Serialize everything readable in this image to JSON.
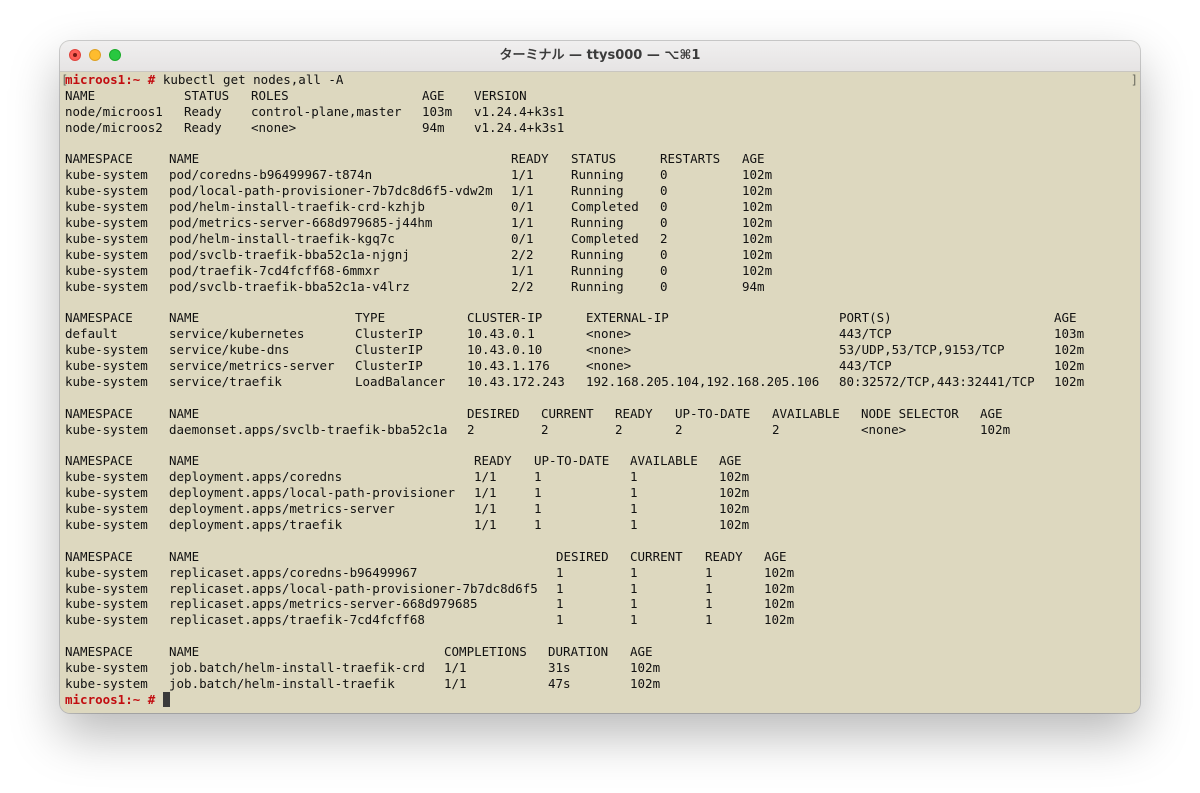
{
  "window": {
    "title": "ターミナル — ttys000 — ⌥⌘1",
    "icons": {
      "close": "close-icon",
      "minimize": "minimize-icon",
      "maximize": "zoom-icon"
    },
    "colors": {
      "background": "#ddd8bf",
      "prompt": "#c20d10",
      "text": "#111111"
    }
  },
  "terminal": {
    "bracket_left": "[",
    "bracket_right": "]",
    "prompt": "microos1:~ #",
    "command": "kubectl get nodes,all -A",
    "final_prompt": "microos1:~ #",
    "sections": [
      {
        "id": "nodes",
        "headers": [
          "NAME",
          "STATUS",
          "ROLES",
          "AGE",
          "VERSION"
        ],
        "rows": [
          [
            "node/microos1",
            "Ready",
            "control-plane,master",
            "103m",
            "v1.24.4+k3s1"
          ],
          [
            "node/microos2",
            "Ready",
            "<none>",
            "94m",
            "v1.24.4+k3s1"
          ]
        ]
      },
      {
        "id": "pods",
        "headers": [
          "NAMESPACE",
          "NAME",
          "READY",
          "STATUS",
          "RESTARTS",
          "AGE"
        ],
        "rows": [
          [
            "kube-system",
            "pod/coredns-b96499967-t874n",
            "1/1",
            "Running",
            "0",
            "102m"
          ],
          [
            "kube-system",
            "pod/local-path-provisioner-7b7dc8d6f5-vdw2m",
            "1/1",
            "Running",
            "0",
            "102m"
          ],
          [
            "kube-system",
            "pod/helm-install-traefik-crd-kzhjb",
            "0/1",
            "Completed",
            "0",
            "102m"
          ],
          [
            "kube-system",
            "pod/metrics-server-668d979685-j44hm",
            "1/1",
            "Running",
            "0",
            "102m"
          ],
          [
            "kube-system",
            "pod/helm-install-traefik-kgq7c",
            "0/1",
            "Completed",
            "2",
            "102m"
          ],
          [
            "kube-system",
            "pod/svclb-traefik-bba52c1a-njgnj",
            "2/2",
            "Running",
            "0",
            "102m"
          ],
          [
            "kube-system",
            "pod/traefik-7cd4fcff68-6mmxr",
            "1/1",
            "Running",
            "0",
            "102m"
          ],
          [
            "kube-system",
            "pod/svclb-traefik-bba52c1a-v4lrz",
            "2/2",
            "Running",
            "0",
            "94m"
          ]
        ]
      },
      {
        "id": "services",
        "headers": [
          "NAMESPACE",
          "NAME",
          "TYPE",
          "CLUSTER-IP",
          "EXTERNAL-IP",
          "PORT(S)",
          "AGE"
        ],
        "rows": [
          [
            "default",
            "service/kubernetes",
            "ClusterIP",
            "10.43.0.1",
            "<none>",
            "443/TCP",
            "103m"
          ],
          [
            "kube-system",
            "service/kube-dns",
            "ClusterIP",
            "10.43.0.10",
            "<none>",
            "53/UDP,53/TCP,9153/TCP",
            "102m"
          ],
          [
            "kube-system",
            "service/metrics-server",
            "ClusterIP",
            "10.43.1.176",
            "<none>",
            "443/TCP",
            "102m"
          ],
          [
            "kube-system",
            "service/traefik",
            "LoadBalancer",
            "10.43.172.243",
            "192.168.205.104,192.168.205.106",
            "80:32572/TCP,443:32441/TCP",
            "102m"
          ]
        ]
      },
      {
        "id": "daemonsets",
        "headers": [
          "NAMESPACE",
          "NAME",
          "DESIRED",
          "CURRENT",
          "READY",
          "UP-TO-DATE",
          "AVAILABLE",
          "NODE SELECTOR",
          "AGE"
        ],
        "rows": [
          [
            "kube-system",
            "daemonset.apps/svclb-traefik-bba52c1a",
            "2",
            "2",
            "2",
            "2",
            "2",
            "<none>",
            "102m"
          ]
        ]
      },
      {
        "id": "deployments",
        "headers": [
          "NAMESPACE",
          "NAME",
          "READY",
          "UP-TO-DATE",
          "AVAILABLE",
          "AGE"
        ],
        "rows": [
          [
            "kube-system",
            "deployment.apps/coredns",
            "1/1",
            "1",
            "1",
            "102m"
          ],
          [
            "kube-system",
            "deployment.apps/local-path-provisioner",
            "1/1",
            "1",
            "1",
            "102m"
          ],
          [
            "kube-system",
            "deployment.apps/metrics-server",
            "1/1",
            "1",
            "1",
            "102m"
          ],
          [
            "kube-system",
            "deployment.apps/traefik",
            "1/1",
            "1",
            "1",
            "102m"
          ]
        ]
      },
      {
        "id": "replicasets",
        "headers": [
          "NAMESPACE",
          "NAME",
          "DESIRED",
          "CURRENT",
          "READY",
          "AGE"
        ],
        "rows": [
          [
            "kube-system",
            "replicaset.apps/coredns-b96499967",
            "1",
            "1",
            "1",
            "102m"
          ],
          [
            "kube-system",
            "replicaset.apps/local-path-provisioner-7b7dc8d6f5",
            "1",
            "1",
            "1",
            "102m"
          ],
          [
            "kube-system",
            "replicaset.apps/metrics-server-668d979685",
            "1",
            "1",
            "1",
            "102m"
          ],
          [
            "kube-system",
            "replicaset.apps/traefik-7cd4fcff68",
            "1",
            "1",
            "1",
            "102m"
          ]
        ]
      },
      {
        "id": "jobs",
        "headers": [
          "NAMESPACE",
          "NAME",
          "COMPLETIONS",
          "DURATION",
          "AGE"
        ],
        "rows": [
          [
            "kube-system",
            "job.batch/helm-install-traefik-crd",
            "1/1",
            "31s",
            "102m"
          ],
          [
            "kube-system",
            "job.batch/helm-install-traefik",
            "1/1",
            "47s",
            "102m"
          ]
        ]
      }
    ]
  }
}
